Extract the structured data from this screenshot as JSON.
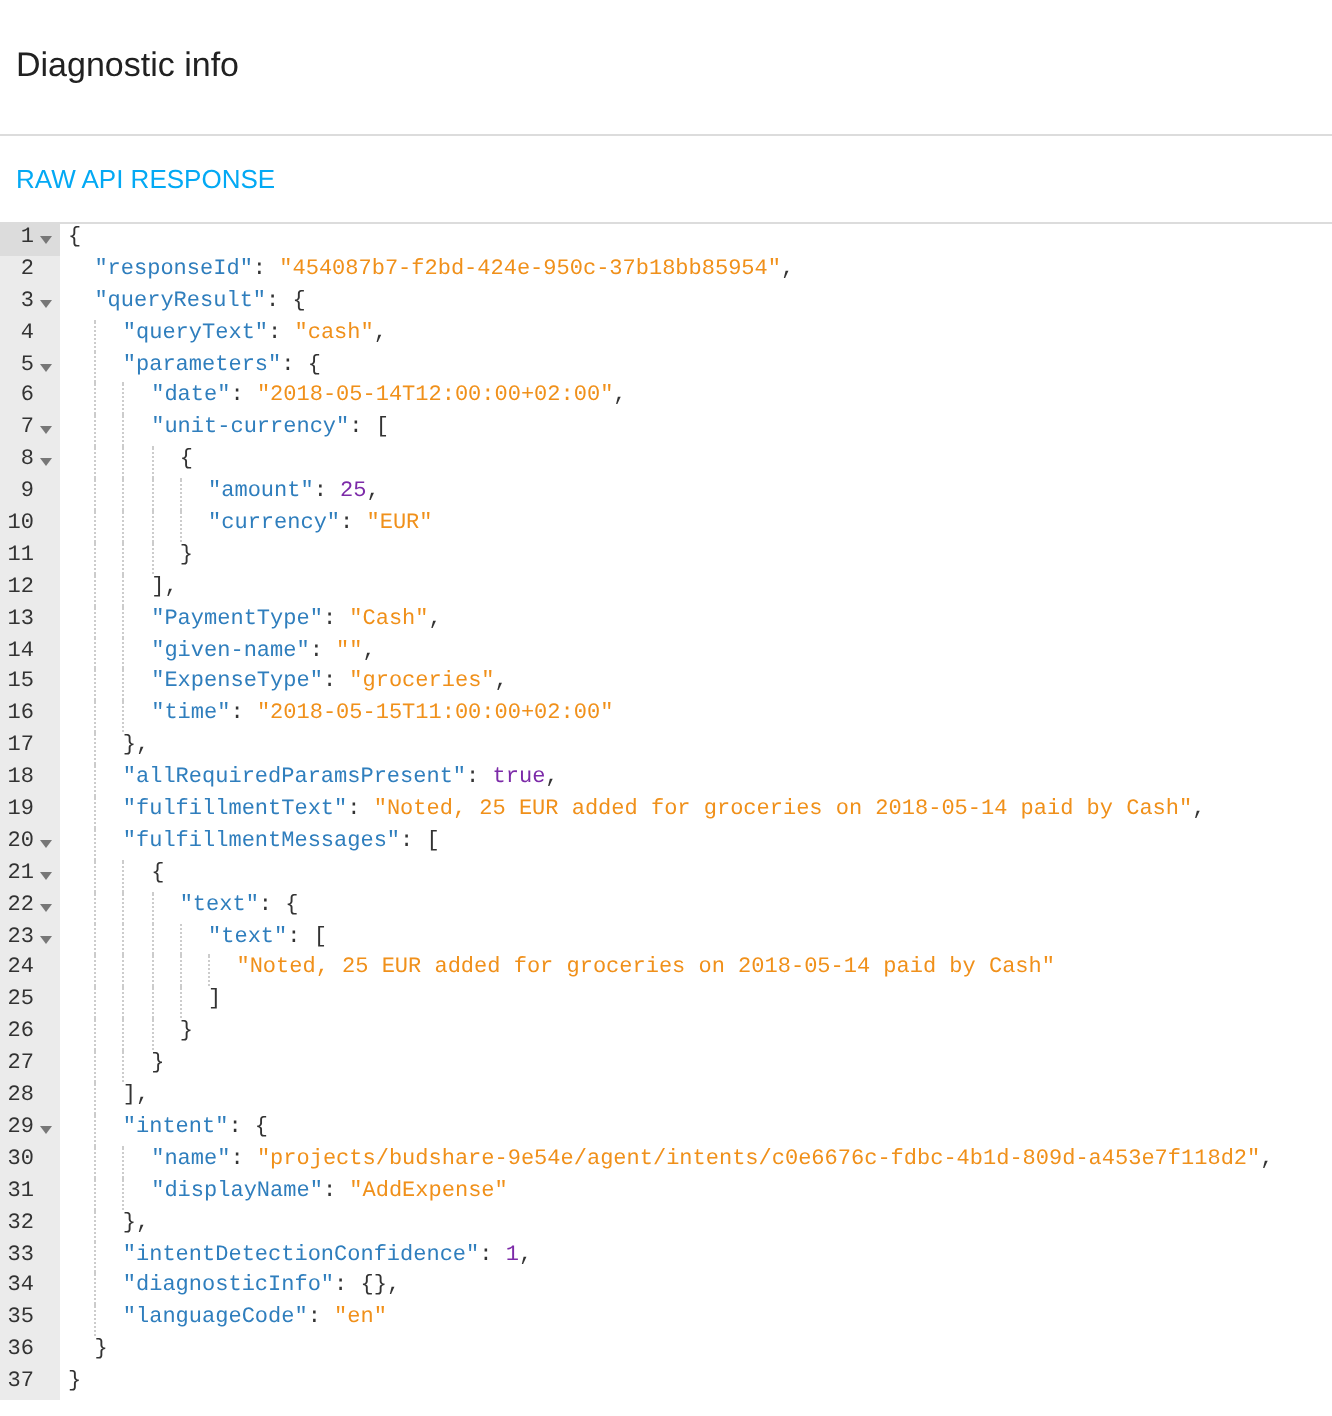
{
  "dialog": {
    "title": "Diagnostic info"
  },
  "tabs": [
    {
      "label": "RAW API RESPONSE",
      "selected": true
    }
  ],
  "editor": {
    "lines": [
      {
        "number": "1",
        "text": "{",
        "foldable": true,
        "active": true
      },
      {
        "number": "2",
        "text": "  \"responseId\": \"454087b7-f2bd-424e-950c-37b18bb85954\",",
        "foldable": false,
        "active": false
      },
      {
        "number": "3",
        "text": "  \"queryResult\": {",
        "foldable": true,
        "active": false
      },
      {
        "number": "4",
        "text": "    \"queryText\": \"cash\",",
        "foldable": false,
        "active": false
      },
      {
        "number": "5",
        "text": "    \"parameters\": {",
        "foldable": true,
        "active": false
      },
      {
        "number": "6",
        "text": "      \"date\": \"2018-05-14T12:00:00+02:00\",",
        "foldable": false,
        "active": false
      },
      {
        "number": "7",
        "text": "      \"unit-currency\": [",
        "foldable": true,
        "active": false
      },
      {
        "number": "8",
        "text": "        {",
        "foldable": true,
        "active": false
      },
      {
        "number": "9",
        "text": "          \"amount\": 25,",
        "foldable": false,
        "active": false
      },
      {
        "number": "10",
        "text": "          \"currency\": \"EUR\"",
        "foldable": false,
        "active": false
      },
      {
        "number": "11",
        "text": "        }",
        "foldable": false,
        "active": false
      },
      {
        "number": "12",
        "text": "      ],",
        "foldable": false,
        "active": false
      },
      {
        "number": "13",
        "text": "      \"PaymentType\": \"Cash\",",
        "foldable": false,
        "active": false
      },
      {
        "number": "14",
        "text": "      \"given-name\": \"\",",
        "foldable": false,
        "active": false
      },
      {
        "number": "15",
        "text": "      \"ExpenseType\": \"groceries\",",
        "foldable": false,
        "active": false
      },
      {
        "number": "16",
        "text": "      \"time\": \"2018-05-15T11:00:00+02:00\"",
        "foldable": false,
        "active": false
      },
      {
        "number": "17",
        "text": "    },",
        "foldable": false,
        "active": false
      },
      {
        "number": "18",
        "text": "    \"allRequiredParamsPresent\": true,",
        "foldable": false,
        "active": false
      },
      {
        "number": "19",
        "text": "    \"fulfillmentText\": \"Noted, 25 EUR added for groceries on 2018-05-14 paid by Cash\",",
        "foldable": false,
        "active": false
      },
      {
        "number": "20",
        "text": "    \"fulfillmentMessages\": [",
        "foldable": true,
        "active": false
      },
      {
        "number": "21",
        "text": "      {",
        "foldable": true,
        "active": false
      },
      {
        "number": "22",
        "text": "        \"text\": {",
        "foldable": true,
        "active": false
      },
      {
        "number": "23",
        "text": "          \"text\": [",
        "foldable": true,
        "active": false
      },
      {
        "number": "24",
        "text": "            \"Noted, 25 EUR added for groceries on 2018-05-14 paid by Cash\"",
        "foldable": false,
        "active": false
      },
      {
        "number": "25",
        "text": "          ]",
        "foldable": false,
        "active": false
      },
      {
        "number": "26",
        "text": "        }",
        "foldable": false,
        "active": false
      },
      {
        "number": "27",
        "text": "      }",
        "foldable": false,
        "active": false
      },
      {
        "number": "28",
        "text": "    ],",
        "foldable": false,
        "active": false
      },
      {
        "number": "29",
        "text": "    \"intent\": {",
        "foldable": true,
        "active": false
      },
      {
        "number": "30",
        "text": "      \"name\": \"projects/budshare-9e54e/agent/intents/c0e6676c-fdbc-4b1d-809d-a453e7f118d2\",",
        "foldable": false,
        "active": false
      },
      {
        "number": "31",
        "text": "      \"displayName\": \"AddExpense\"",
        "foldable": false,
        "active": false
      },
      {
        "number": "32",
        "text": "    },",
        "foldable": false,
        "active": false
      },
      {
        "number": "33",
        "text": "    \"intentDetectionConfidence\": 1,",
        "foldable": false,
        "active": false
      },
      {
        "number": "34",
        "text": "    \"diagnosticInfo\": {},",
        "foldable": false,
        "active": false
      },
      {
        "number": "35",
        "text": "    \"languageCode\": \"en\"",
        "foldable": false,
        "active": false
      },
      {
        "number": "36",
        "text": "  }",
        "foldable": false,
        "active": false
      },
      {
        "number": "37",
        "text": "}",
        "foldable": false,
        "active": false
      }
    ]
  }
}
